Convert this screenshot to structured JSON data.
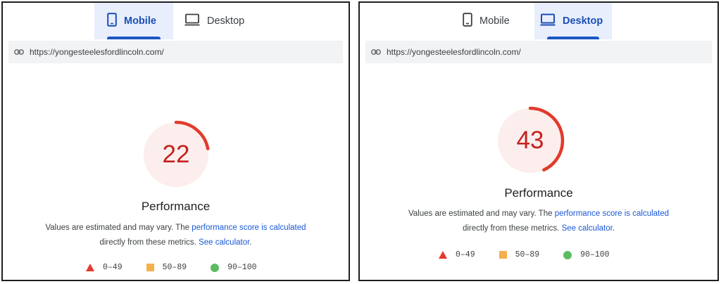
{
  "panels": [
    {
      "id": "mobile",
      "tabs": {
        "mobile_label": "Mobile",
        "desktop_label": "Desktop",
        "active": "mobile"
      },
      "url": "https://yongesteelesfordlincoln.com/",
      "score": 22,
      "category": "Performance",
      "description": {
        "part1": "Values are estimated and may vary. The ",
        "link1": "performance score is calculated",
        "part2": "directly from these metrics. ",
        "link2": "See calculator",
        "part3": "."
      },
      "legend": {
        "fail": "0–49",
        "average": "50–89",
        "pass": "90–100"
      }
    },
    {
      "id": "desktop",
      "tabs": {
        "mobile_label": "Mobile",
        "desktop_label": "Desktop",
        "active": "desktop"
      },
      "url": "https://yongesteelesfordlincoln.com/",
      "score": 43,
      "category": "Performance",
      "description": {
        "part1": "Values are estimated and may vary. The ",
        "link1": "performance score is calculated",
        "part2": "directly from these metrics. ",
        "link2": "See calculator",
        "part3": "."
      },
      "legend": {
        "fail": "0–49",
        "average": "50–89",
        "pass": "90–100"
      }
    }
  ],
  "colors": {
    "fail": "#e33b2e",
    "average": "#f5b04c",
    "pass": "#5dbb63",
    "gauge_bg": "#fceeed",
    "score_text": "#c5221f",
    "link": "#1a57d6",
    "active_tab_bg": "#e8eefb"
  },
  "icons": {
    "mobile_tab": "phone-icon",
    "desktop_tab": "monitor-icon",
    "url": "link-icon"
  }
}
